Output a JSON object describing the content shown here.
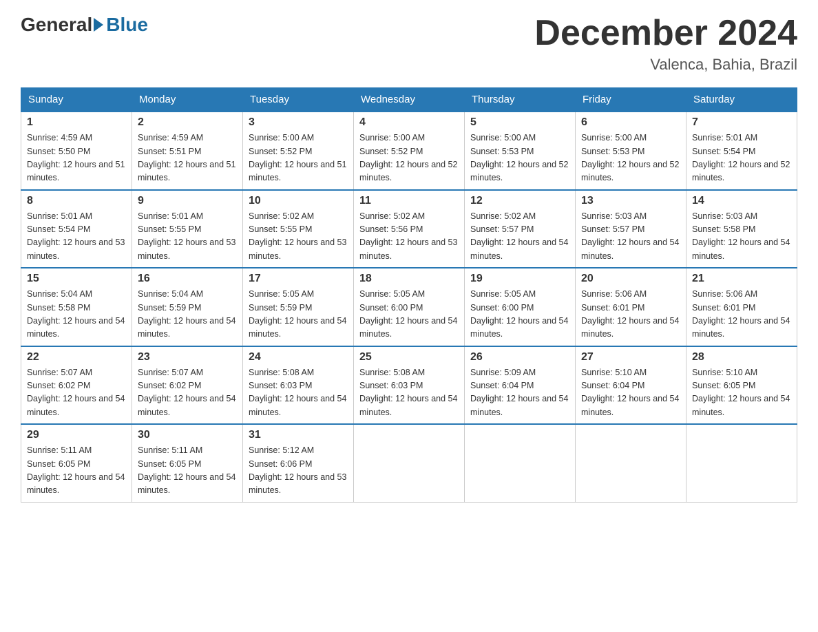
{
  "header": {
    "logo_general": "General",
    "logo_blue": "Blue",
    "month": "December 2024",
    "location": "Valenca, Bahia, Brazil"
  },
  "days_of_week": [
    "Sunday",
    "Monday",
    "Tuesday",
    "Wednesday",
    "Thursday",
    "Friday",
    "Saturday"
  ],
  "weeks": [
    [
      {
        "day": "1",
        "sunrise": "4:59 AM",
        "sunset": "5:50 PM",
        "daylight": "12 hours and 51 minutes"
      },
      {
        "day": "2",
        "sunrise": "4:59 AM",
        "sunset": "5:51 PM",
        "daylight": "12 hours and 51 minutes"
      },
      {
        "day": "3",
        "sunrise": "5:00 AM",
        "sunset": "5:52 PM",
        "daylight": "12 hours and 51 minutes"
      },
      {
        "day": "4",
        "sunrise": "5:00 AM",
        "sunset": "5:52 PM",
        "daylight": "12 hours and 52 minutes"
      },
      {
        "day": "5",
        "sunrise": "5:00 AM",
        "sunset": "5:53 PM",
        "daylight": "12 hours and 52 minutes"
      },
      {
        "day": "6",
        "sunrise": "5:00 AM",
        "sunset": "5:53 PM",
        "daylight": "12 hours and 52 minutes"
      },
      {
        "day": "7",
        "sunrise": "5:01 AM",
        "sunset": "5:54 PM",
        "daylight": "12 hours and 52 minutes"
      }
    ],
    [
      {
        "day": "8",
        "sunrise": "5:01 AM",
        "sunset": "5:54 PM",
        "daylight": "12 hours and 53 minutes"
      },
      {
        "day": "9",
        "sunrise": "5:01 AM",
        "sunset": "5:55 PM",
        "daylight": "12 hours and 53 minutes"
      },
      {
        "day": "10",
        "sunrise": "5:02 AM",
        "sunset": "5:55 PM",
        "daylight": "12 hours and 53 minutes"
      },
      {
        "day": "11",
        "sunrise": "5:02 AM",
        "sunset": "5:56 PM",
        "daylight": "12 hours and 53 minutes"
      },
      {
        "day": "12",
        "sunrise": "5:02 AM",
        "sunset": "5:57 PM",
        "daylight": "12 hours and 54 minutes"
      },
      {
        "day": "13",
        "sunrise": "5:03 AM",
        "sunset": "5:57 PM",
        "daylight": "12 hours and 54 minutes"
      },
      {
        "day": "14",
        "sunrise": "5:03 AM",
        "sunset": "5:58 PM",
        "daylight": "12 hours and 54 minutes"
      }
    ],
    [
      {
        "day": "15",
        "sunrise": "5:04 AM",
        "sunset": "5:58 PM",
        "daylight": "12 hours and 54 minutes"
      },
      {
        "day": "16",
        "sunrise": "5:04 AM",
        "sunset": "5:59 PM",
        "daylight": "12 hours and 54 minutes"
      },
      {
        "day": "17",
        "sunrise": "5:05 AM",
        "sunset": "5:59 PM",
        "daylight": "12 hours and 54 minutes"
      },
      {
        "day": "18",
        "sunrise": "5:05 AM",
        "sunset": "6:00 PM",
        "daylight": "12 hours and 54 minutes"
      },
      {
        "day": "19",
        "sunrise": "5:05 AM",
        "sunset": "6:00 PM",
        "daylight": "12 hours and 54 minutes"
      },
      {
        "day": "20",
        "sunrise": "5:06 AM",
        "sunset": "6:01 PM",
        "daylight": "12 hours and 54 minutes"
      },
      {
        "day": "21",
        "sunrise": "5:06 AM",
        "sunset": "6:01 PM",
        "daylight": "12 hours and 54 minutes"
      }
    ],
    [
      {
        "day": "22",
        "sunrise": "5:07 AM",
        "sunset": "6:02 PM",
        "daylight": "12 hours and 54 minutes"
      },
      {
        "day": "23",
        "sunrise": "5:07 AM",
        "sunset": "6:02 PM",
        "daylight": "12 hours and 54 minutes"
      },
      {
        "day": "24",
        "sunrise": "5:08 AM",
        "sunset": "6:03 PM",
        "daylight": "12 hours and 54 minutes"
      },
      {
        "day": "25",
        "sunrise": "5:08 AM",
        "sunset": "6:03 PM",
        "daylight": "12 hours and 54 minutes"
      },
      {
        "day": "26",
        "sunrise": "5:09 AM",
        "sunset": "6:04 PM",
        "daylight": "12 hours and 54 minutes"
      },
      {
        "day": "27",
        "sunrise": "5:10 AM",
        "sunset": "6:04 PM",
        "daylight": "12 hours and 54 minutes"
      },
      {
        "day": "28",
        "sunrise": "5:10 AM",
        "sunset": "6:05 PM",
        "daylight": "12 hours and 54 minutes"
      }
    ],
    [
      {
        "day": "29",
        "sunrise": "5:11 AM",
        "sunset": "6:05 PM",
        "daylight": "12 hours and 54 minutes"
      },
      {
        "day": "30",
        "sunrise": "5:11 AM",
        "sunset": "6:05 PM",
        "daylight": "12 hours and 54 minutes"
      },
      {
        "day": "31",
        "sunrise": "5:12 AM",
        "sunset": "6:06 PM",
        "daylight": "12 hours and 53 minutes"
      },
      null,
      null,
      null,
      null
    ]
  ]
}
